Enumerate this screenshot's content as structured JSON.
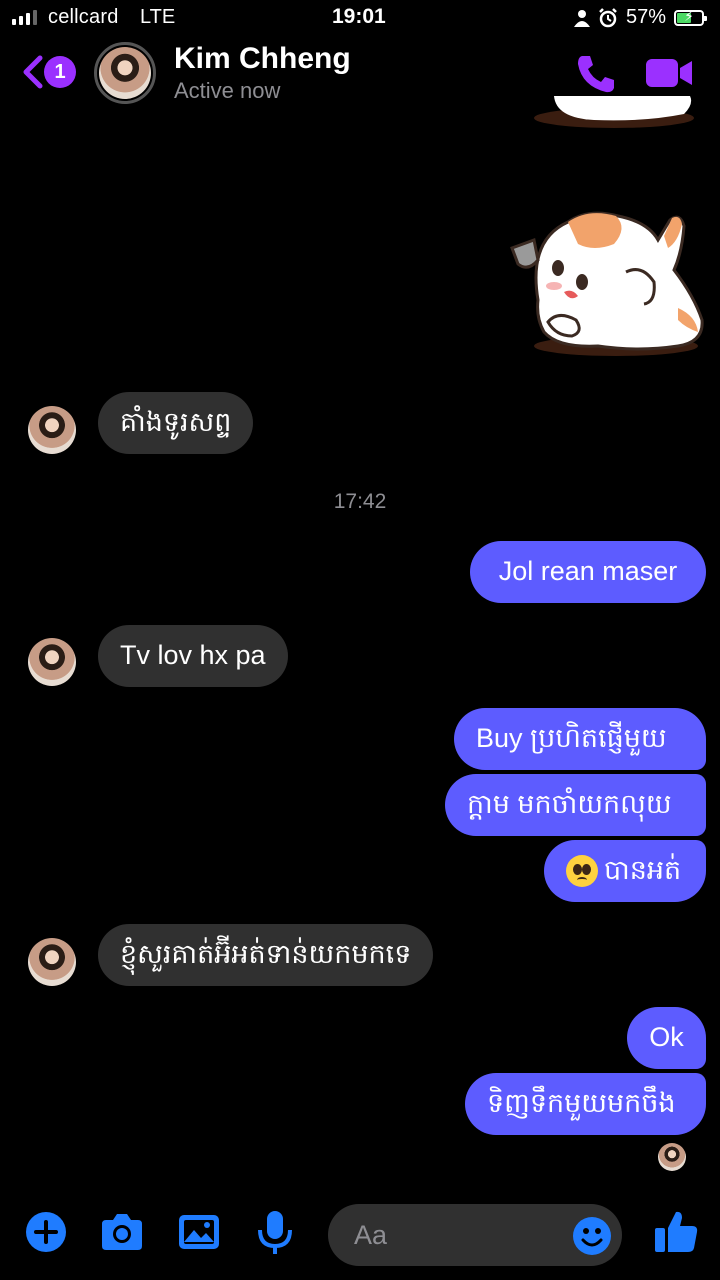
{
  "status_bar": {
    "carrier": "cellcard",
    "network": "LTE",
    "time": "19:01",
    "battery": "57%",
    "battery_level": 0.57
  },
  "header": {
    "back_badge": "1",
    "contact_name": "Kim Chheng",
    "contact_status": "Active now"
  },
  "messages": {
    "m1": "គាំងទូរសព្ទ",
    "timestamp": "17:42",
    "m2": "Jol rean maser",
    "m3": "Tv lov hx pa",
    "m4": "Buy ប្រហិតផ្ញើមួយ",
    "m5": "ក្តាម មកចាំយកលុយ",
    "m6": "បានអត់",
    "m7": "ខ្ញុំសួរគាត់អ៊ីអត់ទាន់យកមកទេ",
    "m8": "Ok",
    "m9": "ទិញទឹកមួយមកចឹង"
  },
  "composer": {
    "placeholder": "Aa"
  },
  "colors": {
    "accent": "#9b30ff",
    "sent_bubble": "#5d5cff",
    "received_bubble": "#303030",
    "composer_icons": "#1f7cff"
  },
  "icons": [
    "back-chevron-icon",
    "phone-icon",
    "video-camera-icon",
    "plus-icon",
    "camera-icon",
    "gallery-icon",
    "microphone-icon",
    "emoji-icon",
    "thumbs-up-icon"
  ]
}
